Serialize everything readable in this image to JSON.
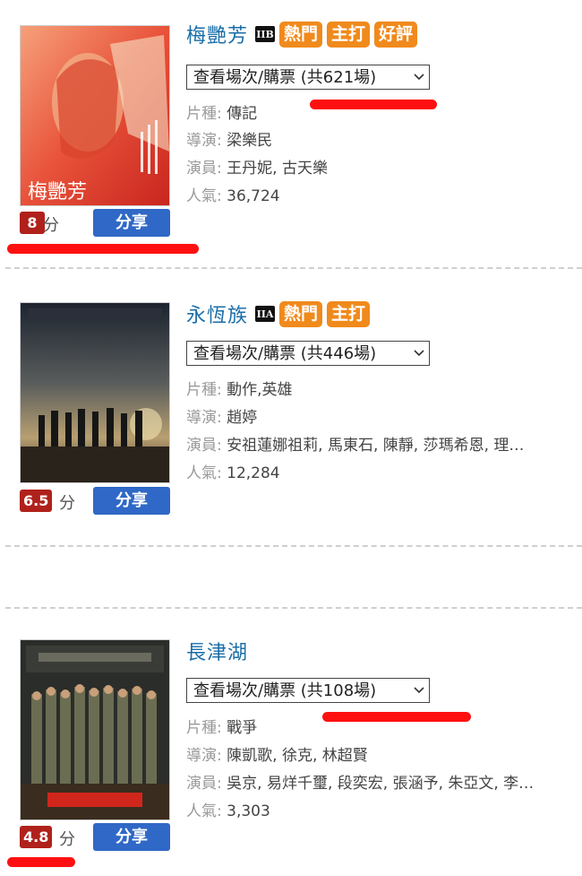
{
  "movies": [
    {
      "title": "梅艷芳",
      "rating_icon": "IIB",
      "tags": [
        "熱門",
        "主打",
        "好評"
      ],
      "showtime_label": "查看場次/購票 (共621場)",
      "genre_label": "片種:",
      "genre": "傳記",
      "director_label": "導演:",
      "director": "梁樂民",
      "cast_label": "演員:",
      "cast": "王丹妮, 古天樂",
      "popularity_label": "人氣:",
      "popularity": "36,724",
      "score": "8",
      "score_unit": "分",
      "share_label": "分享"
    },
    {
      "title": "永恆族",
      "rating_icon": "IIA",
      "tags": [
        "熱門",
        "主打"
      ],
      "showtime_label": "查看場次/購票 (共446場)",
      "genre_label": "片種:",
      "genre": "動作,英雄",
      "director_label": "導演:",
      "director": "趙婷",
      "cast_label": "演員:",
      "cast": "安祖蓮娜祖莉, 馬東石, 陳靜, 莎瑪希恩, 理…",
      "popularity_label": "人氣:",
      "popularity": "12,284",
      "score": "6.5",
      "score_unit": "分",
      "share_label": "分享"
    },
    {
      "title": "長津湖",
      "showtime_label": "查看場次/購票 (共108場)",
      "genre_label": "片種:",
      "genre": "戰爭",
      "director_label": "導演:",
      "director": "陳凱歌, 徐克, 林超賢",
      "cast_label": "演員:",
      "cast": "吳京, 易烊千璽, 段奕宏, 張涵予, 朱亞文, 李…",
      "popularity_label": "人氣:",
      "popularity": "3,303",
      "score": "4.8",
      "score_unit": "分",
      "share_label": "分享"
    }
  ],
  "colors": {
    "title": "#1a6ea8",
    "tag": "#f08a1c",
    "score": "#b0211b",
    "share": "#2f68c6",
    "highlight": "#ff1010"
  }
}
